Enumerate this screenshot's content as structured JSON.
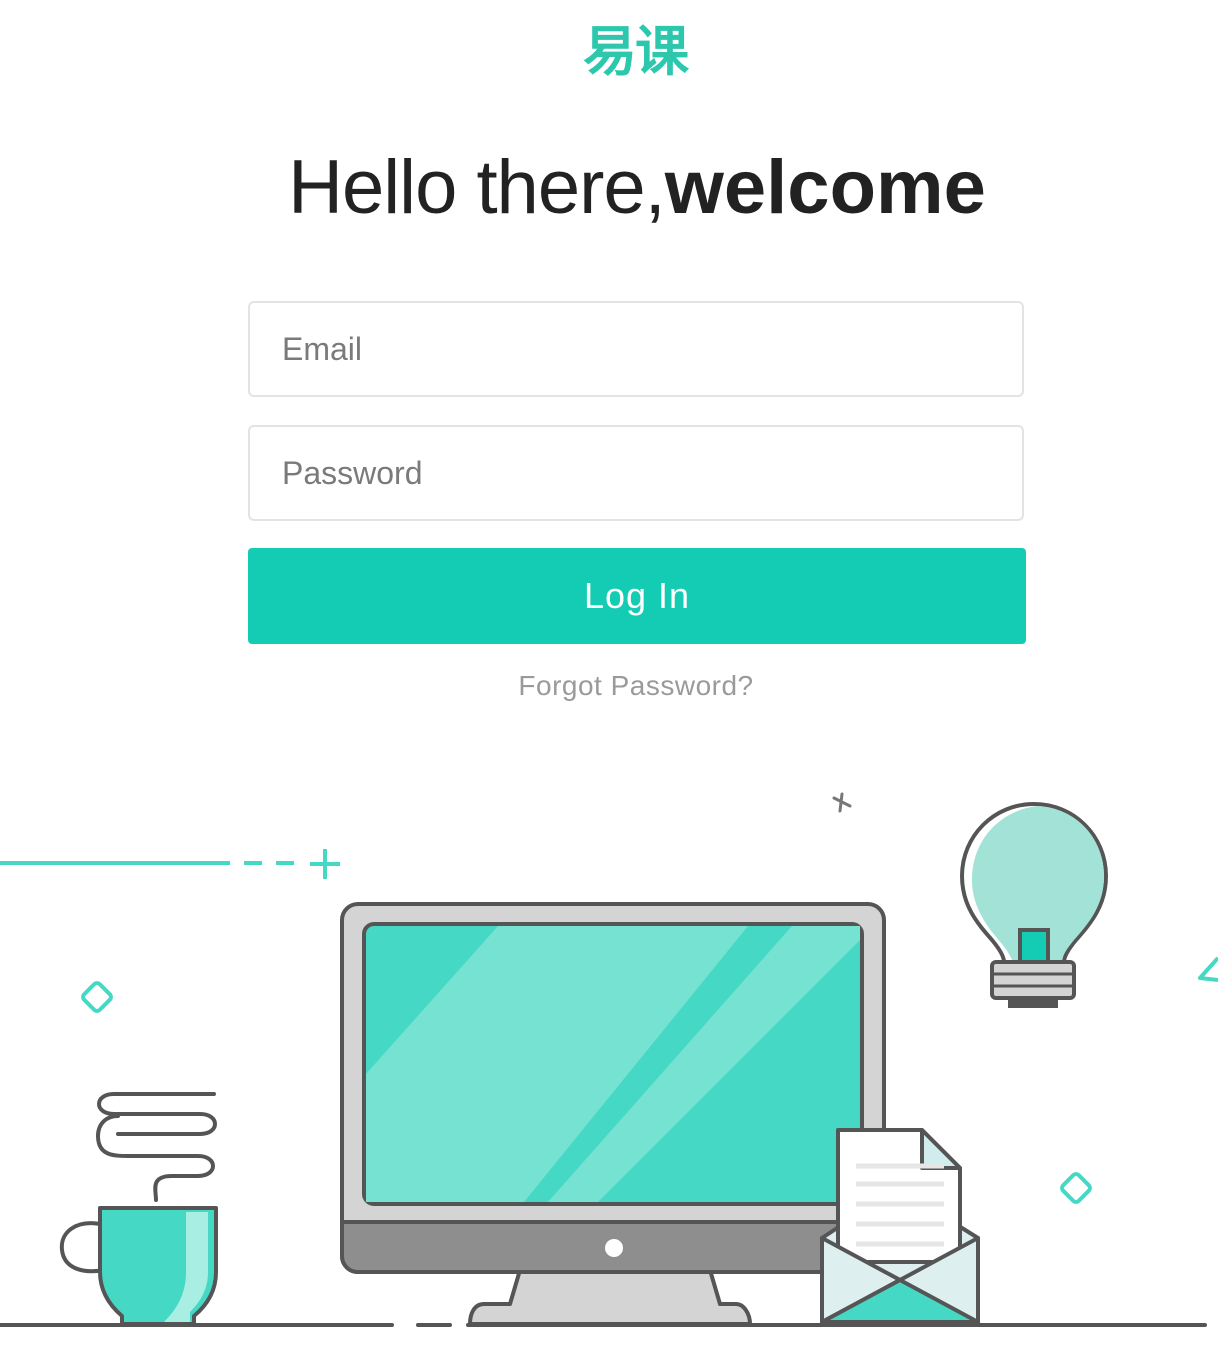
{
  "app": {
    "logo_text": "易课"
  },
  "headline": {
    "light": "Hello there,",
    "bold": "welcome"
  },
  "form": {
    "email_placeholder": "Email",
    "password_placeholder": "Password",
    "login_label": "Log In",
    "forgot_label": "Forgot Password?"
  },
  "colors": {
    "accent": "#14ccb4",
    "logo": "#2cc7ad",
    "illustration_teal": "#45d9c5",
    "illustration_light_teal": "#76e2d2",
    "outline": "#555555"
  },
  "illustration": {
    "icons": [
      "coffee-cup-icon",
      "steam-icon",
      "monitor-icon",
      "envelope-icon",
      "document-icon",
      "lightbulb-icon",
      "diamond-icon",
      "plus-icon",
      "cross-icon",
      "triangle-icon"
    ]
  }
}
